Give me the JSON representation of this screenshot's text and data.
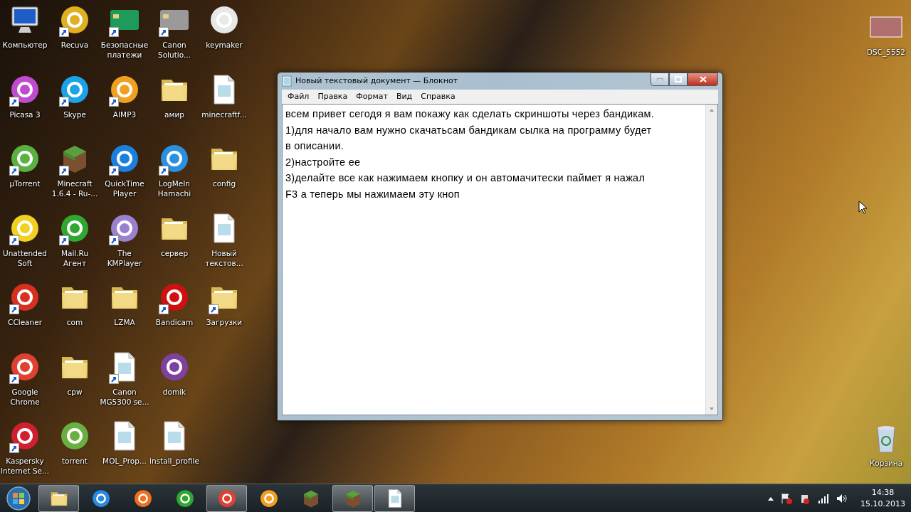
{
  "desktop": {
    "rows": [
      [
        {
          "label": "Компьютер",
          "kind": "computer",
          "shortcut": false
        },
        {
          "label": "Recuva",
          "kind": "app",
          "color": "#e0b020",
          "shortcut": true
        },
        {
          "label": "Безопасные платежи",
          "kind": "card",
          "color": "#1e9a5a",
          "shortcut": true
        },
        {
          "label": "Canon Solutio...",
          "kind": "card",
          "color": "#9a9a9a",
          "shortcut": true
        },
        {
          "label": "keymaker",
          "kind": "app",
          "color": "#e8e8e8",
          "shortcut": false
        }
      ],
      [
        {
          "label": "Picasa 3",
          "kind": "app",
          "color": "#c04ad0",
          "shortcut": true
        },
        {
          "label": "Skype",
          "kind": "app",
          "color": "#1aa3e8",
          "shortcut": true
        },
        {
          "label": "AIMP3",
          "kind": "app",
          "color": "#f0a020",
          "shortcut": true
        },
        {
          "label": "амир",
          "kind": "folder",
          "shortcut": false
        },
        {
          "label": "minecraftf...",
          "kind": "document",
          "shortcut": false
        }
      ],
      [
        {
          "label": "µTorrent",
          "kind": "app",
          "color": "#5ab040",
          "shortcut": true
        },
        {
          "label": "Minecraft 1.6.4 - Ru-...",
          "kind": "block",
          "shortcut": true
        },
        {
          "label": "QuickTime Player",
          "kind": "app",
          "color": "#1a80e0",
          "shortcut": true
        },
        {
          "label": "LogMeIn Hamachi",
          "kind": "app",
          "color": "#2a90e0",
          "shortcut": true
        },
        {
          "label": "config",
          "kind": "folder",
          "shortcut": false
        }
      ],
      [
        {
          "label": "Unattended Soft",
          "kind": "app",
          "color": "#f0d020",
          "shortcut": true
        },
        {
          "label": "Mail.Ru Агент",
          "kind": "app",
          "color": "#30a830",
          "shortcut": true
        },
        {
          "label": "The KMPlayer",
          "kind": "app",
          "color": "#9a80d0",
          "shortcut": true
        },
        {
          "label": "сервер",
          "kind": "folder",
          "shortcut": false
        },
        {
          "label": "Новый текстов...",
          "kind": "document",
          "shortcut": false
        }
      ],
      [
        {
          "label": "CCleaner",
          "kind": "app",
          "color": "#d83020",
          "shortcut": true
        },
        {
          "label": "com",
          "kind": "folder",
          "shortcut": false
        },
        {
          "label": "LZMA",
          "kind": "folder",
          "shortcut": false
        },
        {
          "label": "Bandicam",
          "kind": "app",
          "color": "#d01010",
          "shortcut": true
        },
        {
          "label": "Загрузки",
          "kind": "folder",
          "shortcut": true
        }
      ],
      [
        {
          "label": "Google Chrome",
          "kind": "app",
          "color": "#e04030",
          "shortcut": true
        },
        {
          "label": "cpw",
          "kind": "folder",
          "shortcut": false
        },
        {
          "label": "Canon MG5300 se...",
          "kind": "document",
          "shortcut": true
        },
        {
          "label": "domik",
          "kind": "app",
          "color": "#8040a0",
          "shortcut": false
        }
      ],
      [
        {
          "label": "Kaspersky Internet Se...",
          "kind": "app",
          "color": "#d02030",
          "shortcut": true
        },
        {
          "label": "torrent",
          "kind": "app",
          "color": "#6ab040",
          "shortcut": false
        },
        {
          "label": "MOL_Prop...",
          "kind": "document",
          "shortcut": false
        },
        {
          "label": "install_profile",
          "kind": "document",
          "shortcut": false
        }
      ]
    ],
    "right_icons": [
      {
        "label": "DSC_5552",
        "kind": "photo",
        "shortcut": false
      },
      {
        "label": "Корзина",
        "kind": "recycle-bin",
        "shortcut": false
      }
    ]
  },
  "notepad": {
    "title": "Новый текстовый документ — Блокнот",
    "menu": [
      "Файл",
      "Правка",
      "Формат",
      "Вид",
      "Справка"
    ],
    "lines": [
      "всем привет сегодя я вам покажу как сделать скриншоты через бандикам.",
      "1)для начало вам нужно скачатьсам бандикам сылка на программу будет",
      "в описании.",
      "2)настройте ее",
      "3)делайте все как нажимаем кнопку и он автомачитески паймет я нажал",
      "F3 а теперь мы нажимаем эту кноп"
    ]
  },
  "taskbar": {
    "items": [
      {
        "kind": "folder",
        "active": true
      },
      {
        "kind": "app",
        "color": "#2a8ae0",
        "active": false
      },
      {
        "kind": "app",
        "color": "#f07020",
        "active": false
      },
      {
        "kind": "app",
        "color": "#30a830",
        "active": false
      },
      {
        "kind": "app",
        "color": "#e04030",
        "active": true
      },
      {
        "kind": "app",
        "color": "#f0a020",
        "active": false
      },
      {
        "kind": "block",
        "active": false
      },
      {
        "kind": "block",
        "active": true
      },
      {
        "kind": "document",
        "active": true
      }
    ],
    "clock": {
      "time": "14:38",
      "date": "15.10.2013"
    }
  }
}
